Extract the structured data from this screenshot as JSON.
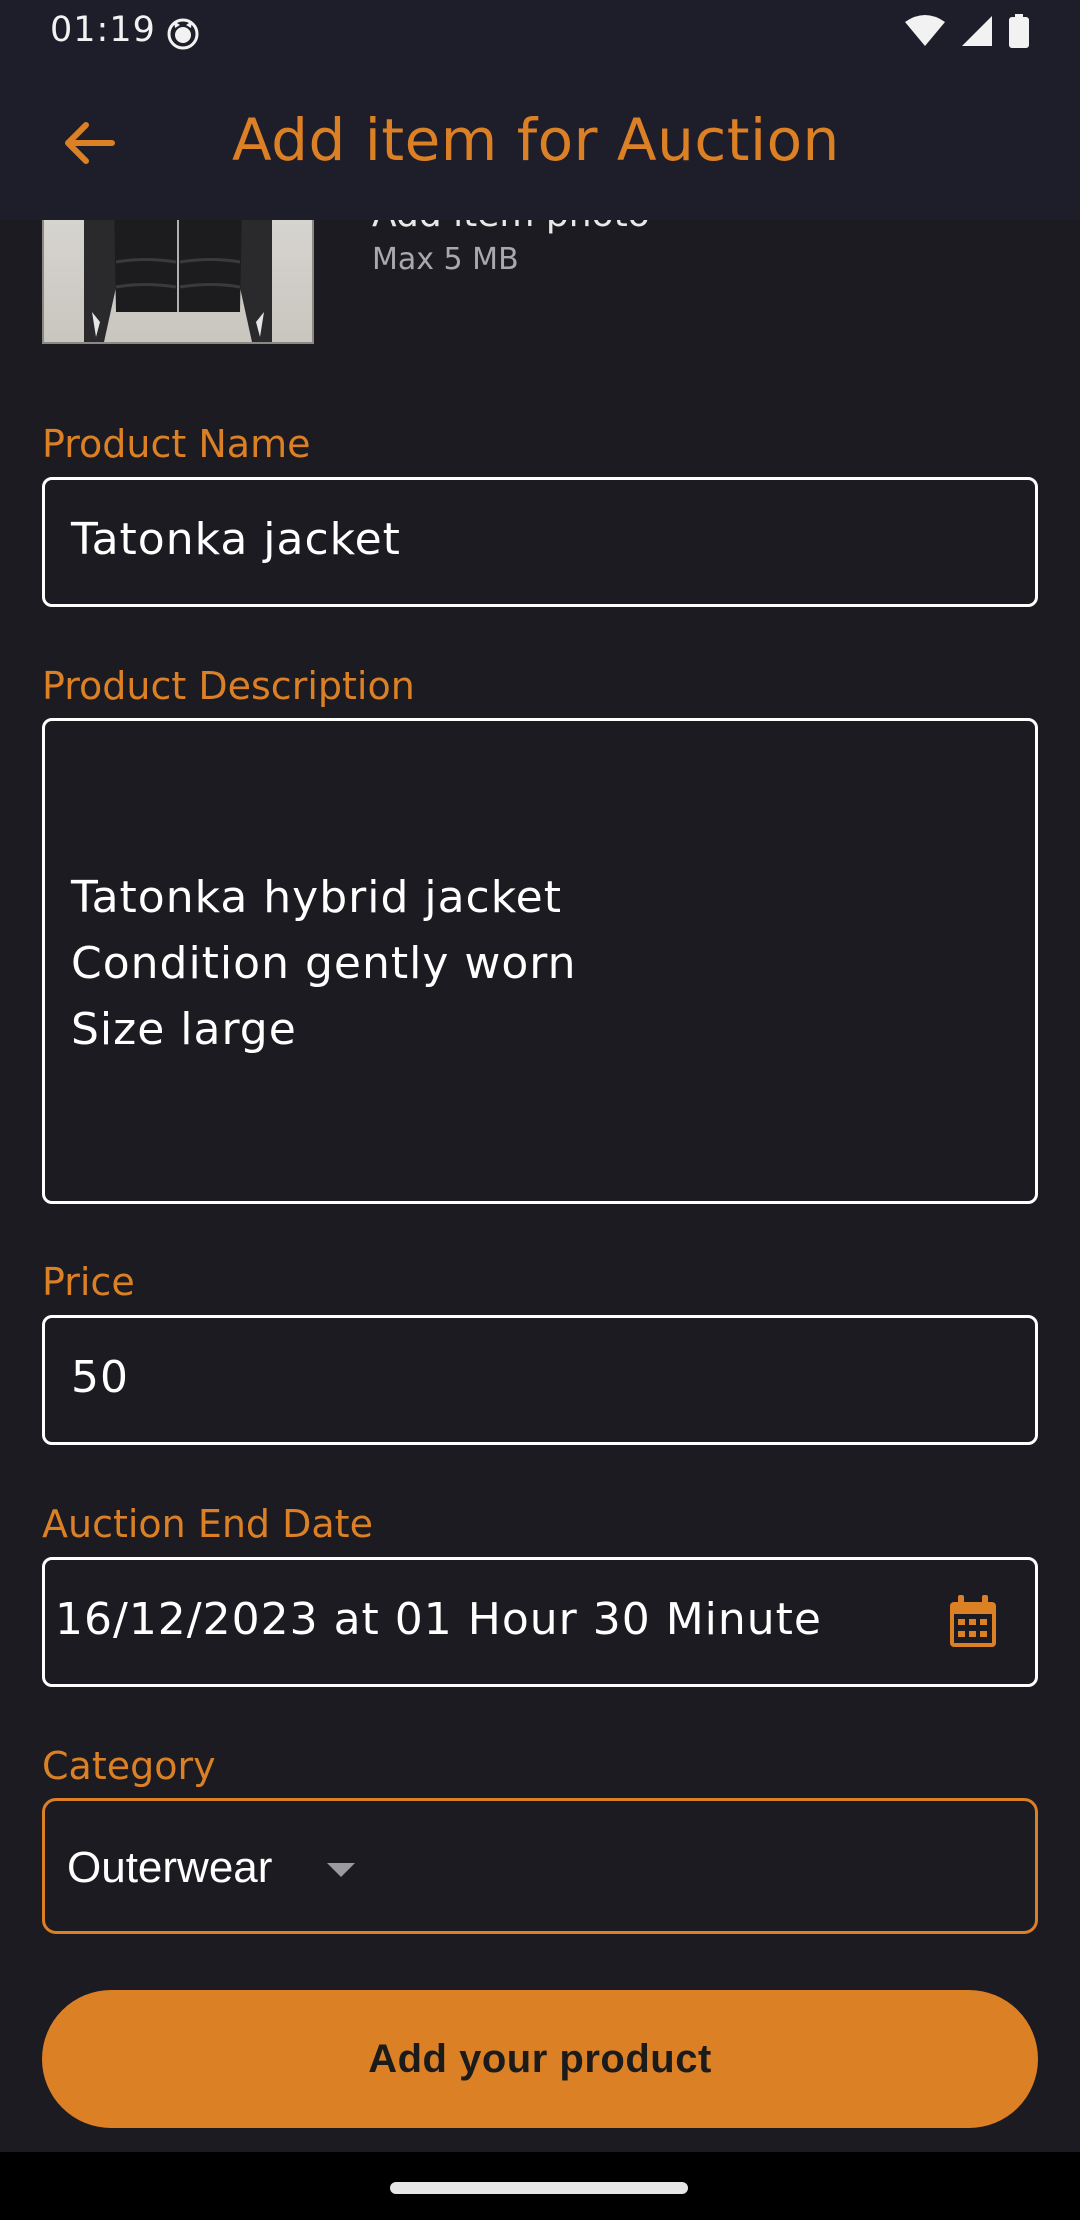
{
  "status_bar": {
    "time": "01:19"
  },
  "app_bar": {
    "title": "Add item for Auction"
  },
  "photo": {
    "title": "Add item photo",
    "subtitle": "Max 5 MB"
  },
  "form": {
    "name": {
      "label": "Product Name",
      "value": "Tatonka jacket"
    },
    "description": {
      "label": "Product Description",
      "lines": [
        "Tatonka hybrid jacket",
        "Condition gently worn",
        "Size large"
      ]
    },
    "price": {
      "label": "Price",
      "value": "50"
    },
    "end_date": {
      "label": "Auction End Date",
      "value": "16/12/2023 at 01 Hour 30 Minute"
    },
    "category": {
      "label": "Category",
      "value": "Outerwear"
    }
  },
  "submit": {
    "label": "Add your product"
  },
  "colors": {
    "accent": "#dc8026",
    "background": "#1b1b21",
    "bar": "#1e1e2a"
  }
}
